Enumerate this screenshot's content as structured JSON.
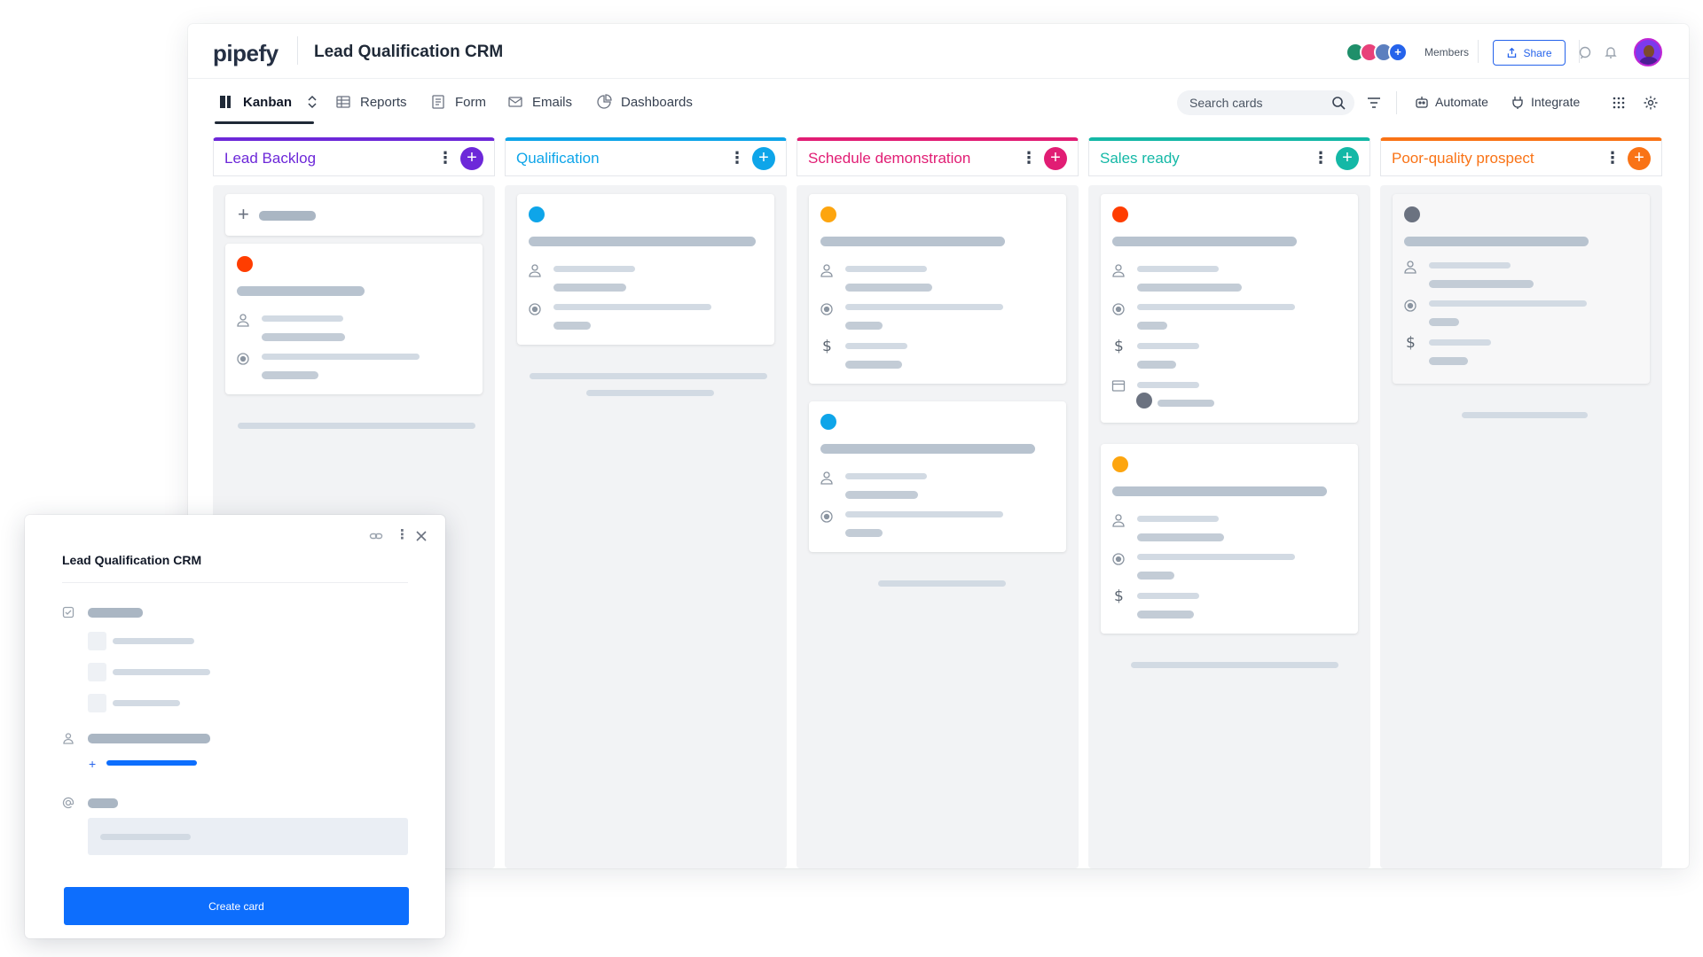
{
  "app": {
    "logo_text": "pipefy",
    "pipe_title": "Lead Qualification CRM",
    "members_label": "Members",
    "share_label": "Share"
  },
  "nav": {
    "tabs": [
      {
        "label": "Kanban",
        "icon": "kanban-icon",
        "active": true
      },
      {
        "label": "Reports",
        "icon": "table-icon"
      },
      {
        "label": "Form",
        "icon": "form-icon"
      },
      {
        "label": "Emails",
        "icon": "mail-icon"
      },
      {
        "label": "Dashboards",
        "icon": "pie-chart-icon"
      }
    ],
    "search_placeholder": "Search cards",
    "automate_label": "Automate",
    "integrate_label": "Integrate"
  },
  "columns": [
    {
      "title": "Lead Backlog",
      "color": "#6d28d9"
    },
    {
      "title": "Qualification",
      "color": "#0ea5e9"
    },
    {
      "title": "Schedule demonstration",
      "color": "#e11d74"
    },
    {
      "title": "Sales ready",
      "color": "#14b8a6"
    },
    {
      "title": "Poor-quality prospect",
      "color": "#f97316"
    }
  ],
  "label_colors": {
    "red": "#ff3d00",
    "blue": "#0ea5e9",
    "orange": "#fda50f",
    "gray": "#6b7280",
    "primary": "#0d6efd"
  },
  "panel": {
    "title": "Lead Qualification CRM",
    "add_glyph": "+",
    "create_button": "Create card"
  }
}
